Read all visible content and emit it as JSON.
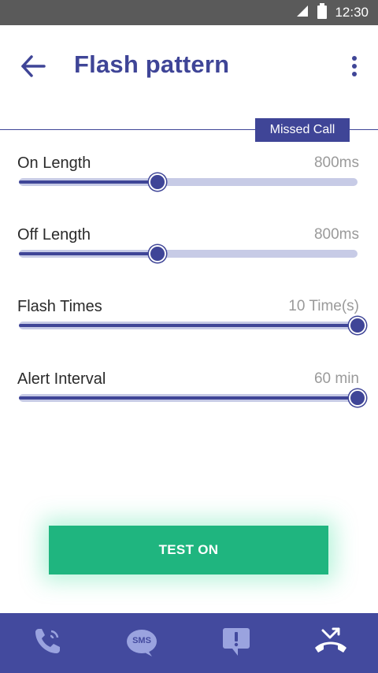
{
  "status_bar": {
    "time": "12:30"
  },
  "header": {
    "title": "Flash pattern"
  },
  "mode_badge": "Missed Call",
  "settings": [
    {
      "label": "On Length",
      "value": "800ms",
      "level": 0.41
    },
    {
      "label": "Off Length",
      "value": "800ms",
      "level": 0.41
    },
    {
      "label": "Flash Times",
      "value": "10 Time(s)",
      "level": 1.0
    },
    {
      "label": "Alert Interval",
      "value": "60 min",
      "level": 1.0
    }
  ],
  "test_button": {
    "label": "TEST ON"
  },
  "bottom_nav": {
    "items": [
      {
        "icon": "phone-icon"
      },
      {
        "icon": "sms-icon",
        "label": "SMS"
      },
      {
        "icon": "alert-icon"
      },
      {
        "icon": "missed-call-icon",
        "selected": true
      }
    ]
  },
  "colors": {
    "primary": "#3f4597",
    "track": "#c7cbe6",
    "button": "#1fb57f",
    "nav": "#434a9e"
  }
}
